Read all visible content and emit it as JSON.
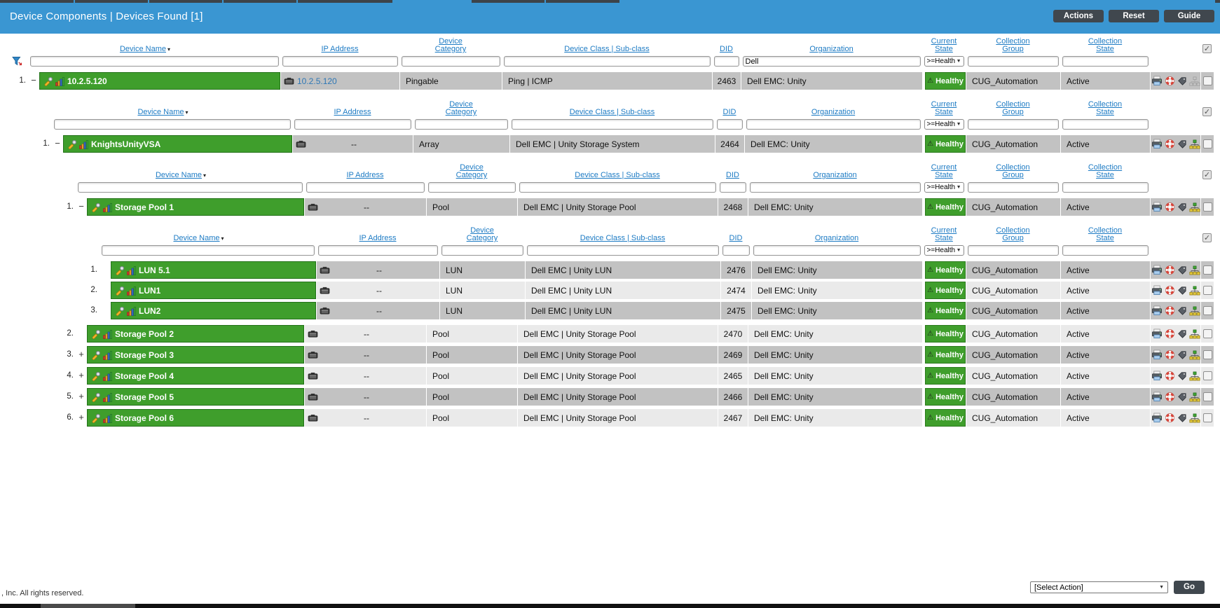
{
  "window": {
    "title": "Device Components | Devices Found [1]",
    "buttons": [
      {
        "label": "Actions"
      },
      {
        "label": "Reset"
      },
      {
        "label": "Guide"
      }
    ]
  },
  "columns": {
    "device_name": "Device Name",
    "ip_address": "IP Address",
    "device_category": "Device Category",
    "device_class": "Device Class | Sub-class",
    "did": "DID",
    "organization": "Organization",
    "current_state": "Current State",
    "collection_group": "Collection Group",
    "collection_state": "Collection State"
  },
  "colors": {
    "header_blue": "#3a96d2",
    "device_green": "#3f9e2c",
    "row_dark": "#c2c2c2",
    "row_light": "#eaeaea",
    "button_dark": "#40474e",
    "link_blue": "#1d7bc4"
  },
  "tables": [
    {
      "level": 0,
      "show_header": true,
      "show_funnel": true,
      "filters": {
        "device_name": "",
        "ip_address": "",
        "device_category": "",
        "device_class": "",
        "did": "",
        "organization": "Dell",
        "current_state": ">=Health",
        "collection_group": "",
        "collection_state": ""
      },
      "rows": [
        {
          "num": "1.",
          "expander": "−",
          "name": "10.2.5.120",
          "ip": "10.2.5.120",
          "ip_link": true,
          "category": "Pingable",
          "device_class": "Ping | ICMP",
          "did": "2463",
          "organization": "Dell EMC: Unity",
          "state": "Healthy",
          "collection_group": "CUG_Automation",
          "collection_state": "Active",
          "shade": "dark",
          "topology_dim": true
        }
      ]
    },
    {
      "level": 1,
      "show_header": true,
      "show_funnel": false,
      "filters": {
        "device_name": "",
        "ip_address": "",
        "device_category": "",
        "device_class": "",
        "did": "",
        "organization": "",
        "current_state": ">=Health",
        "collection_group": "",
        "collection_state": ""
      },
      "rows": [
        {
          "num": "1.",
          "expander": "−",
          "name": "KnightsUnityVSA",
          "ip": "--",
          "ip_link": false,
          "category": "Array",
          "device_class": "Dell EMC | Unity Storage System",
          "did": "2464",
          "organization": "Dell EMC: Unity",
          "state": "Healthy",
          "collection_group": "CUG_Automation",
          "collection_state": "Active",
          "shade": "dark",
          "topology_dim": false
        }
      ]
    },
    {
      "level": 2,
      "show_header": true,
      "show_funnel": false,
      "filters": {
        "device_name": "",
        "ip_address": "",
        "device_category": "",
        "device_class": "",
        "did": "",
        "organization": "",
        "current_state": ">=Health",
        "collection_group": "",
        "collection_state": ""
      },
      "rows": [
        {
          "num": "1.",
          "expander": "−",
          "name": "Storage Pool 1",
          "ip": "--",
          "ip_link": false,
          "category": "Pool",
          "device_class": "Dell EMC | Unity Storage Pool",
          "did": "2468",
          "organization": "Dell EMC: Unity",
          "state": "Healthy",
          "collection_group": "CUG_Automation",
          "collection_state": "Active",
          "shade": "dark",
          "topology_dim": false
        }
      ]
    },
    {
      "level": 3,
      "show_header": true,
      "show_funnel": false,
      "filters": {
        "device_name": "",
        "ip_address": "",
        "device_category": "",
        "device_class": "",
        "did": "",
        "organization": "",
        "current_state": ">=Health",
        "collection_group": "",
        "collection_state": ""
      },
      "rows": [
        {
          "num": "1.",
          "expander": "",
          "name": "LUN 5.1",
          "ip": "--",
          "ip_link": false,
          "category": "LUN",
          "device_class": "Dell EMC | Unity LUN",
          "did": "2476",
          "organization": "Dell EMC: Unity",
          "state": "Healthy",
          "collection_group": "CUG_Automation",
          "collection_state": "Active",
          "shade": "dark",
          "topology_dim": false
        },
        {
          "num": "2.",
          "expander": "",
          "name": "LUN1",
          "ip": "--",
          "ip_link": false,
          "category": "LUN",
          "device_class": "Dell EMC | Unity LUN",
          "did": "2474",
          "organization": "Dell EMC: Unity",
          "state": "Healthy",
          "collection_group": "CUG_Automation",
          "collection_state": "Active",
          "shade": "light",
          "topology_dim": false
        },
        {
          "num": "3.",
          "expander": "",
          "name": "LUN2",
          "ip": "--",
          "ip_link": false,
          "category": "LUN",
          "device_class": "Dell EMC | Unity LUN",
          "did": "2475",
          "organization": "Dell EMC: Unity",
          "state": "Healthy",
          "collection_group": "CUG_Automation",
          "collection_state": "Active",
          "shade": "dark",
          "topology_dim": false
        }
      ]
    },
    {
      "level": 2,
      "show_header": false,
      "show_funnel": false,
      "filters": {
        "device_name": "",
        "ip_address": "",
        "device_category": "",
        "device_class": "",
        "did": "",
        "organization": "",
        "current_state": ">=Health",
        "collection_group": "",
        "collection_state": ""
      },
      "rows": [
        {
          "num": "2.",
          "expander": "",
          "name": "Storage Pool 2",
          "ip": "--",
          "ip_link": false,
          "category": "Pool",
          "device_class": "Dell EMC | Unity Storage Pool",
          "did": "2470",
          "organization": "Dell EMC: Unity",
          "state": "Healthy",
          "collection_group": "CUG_Automation",
          "collection_state": "Active",
          "shade": "light",
          "topology_dim": false
        },
        {
          "num": "3.",
          "expander": "+",
          "name": "Storage Pool 3",
          "ip": "--",
          "ip_link": false,
          "category": "Pool",
          "device_class": "Dell EMC | Unity Storage Pool",
          "did": "2469",
          "organization": "Dell EMC: Unity",
          "state": "Healthy",
          "collection_group": "CUG_Automation",
          "collection_state": "Active",
          "shade": "dark",
          "topology_dim": false
        },
        {
          "num": "4.",
          "expander": "+",
          "name": "Storage Pool 4",
          "ip": "--",
          "ip_link": false,
          "category": "Pool",
          "device_class": "Dell EMC | Unity Storage Pool",
          "did": "2465",
          "organization": "Dell EMC: Unity",
          "state": "Healthy",
          "collection_group": "CUG_Automation",
          "collection_state": "Active",
          "shade": "light",
          "topology_dim": false
        },
        {
          "num": "5.",
          "expander": "+",
          "name": "Storage Pool 5",
          "ip": "--",
          "ip_link": false,
          "category": "Pool",
          "device_class": "Dell EMC | Unity Storage Pool",
          "did": "2466",
          "organization": "Dell EMC: Unity",
          "state": "Healthy",
          "collection_group": "CUG_Automation",
          "collection_state": "Active",
          "shade": "dark",
          "topology_dim": false
        },
        {
          "num": "6.",
          "expander": "+",
          "name": "Storage Pool 6",
          "ip": "--",
          "ip_link": false,
          "category": "Pool",
          "device_class": "Dell EMC | Unity Storage Pool",
          "did": "2467",
          "organization": "Dell EMC: Unity",
          "state": "Healthy",
          "collection_group": "CUG_Automation",
          "collection_state": "Active",
          "shade": "light",
          "topology_dim": false
        }
      ]
    }
  ],
  "footer": {
    "copyright": ", Inc. All rights reserved.",
    "action_select": "[Select Action]",
    "go": "Go"
  }
}
